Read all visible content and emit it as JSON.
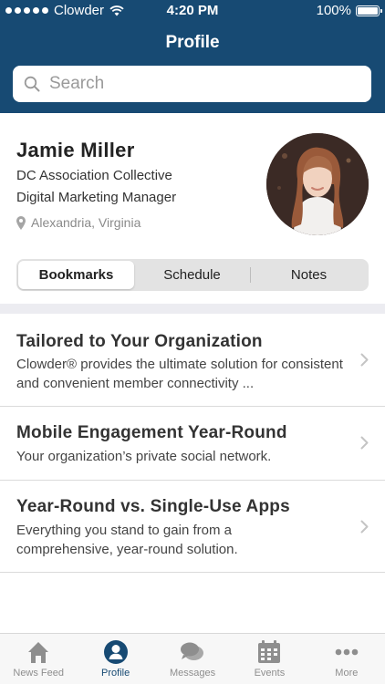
{
  "status_bar": {
    "carrier": "Clowder",
    "time": "4:20 PM",
    "battery": "100%"
  },
  "header": {
    "title": "Profile"
  },
  "search": {
    "placeholder": "Search"
  },
  "profile": {
    "name": "Jamie Miller",
    "organization": "DC Association Collective",
    "role": "Digital Marketing Manager",
    "location": "Alexandria, Virginia"
  },
  "segments": [
    {
      "label": "Bookmarks",
      "active": true
    },
    {
      "label": "Schedule",
      "active": false
    },
    {
      "label": "Notes",
      "active": false
    }
  ],
  "bookmarks": [
    {
      "title": "Tailored to Your Organization",
      "description": "Clowder® provides the ultimate solution for consistent and convenient member connectivity ..."
    },
    {
      "title": "Mobile Engagement Year-Round",
      "description": "Your organization’s private social network."
    },
    {
      "title": "Year-Round vs. Single-Use Apps",
      "description": "Everything you stand to gain from a comprehensive, year-round solution."
    }
  ],
  "tabbar": [
    {
      "label": "News Feed",
      "icon": "home-icon",
      "active": false
    },
    {
      "label": "Profile",
      "icon": "profile-icon",
      "active": true
    },
    {
      "label": "Messages",
      "icon": "messages-icon",
      "active": false
    },
    {
      "label": "Events",
      "icon": "calendar-icon",
      "active": false
    },
    {
      "label": "More",
      "icon": "more-icon",
      "active": false
    }
  ],
  "colors": {
    "brand": "#174a73",
    "inactive_tab": "#8e8e8e"
  }
}
